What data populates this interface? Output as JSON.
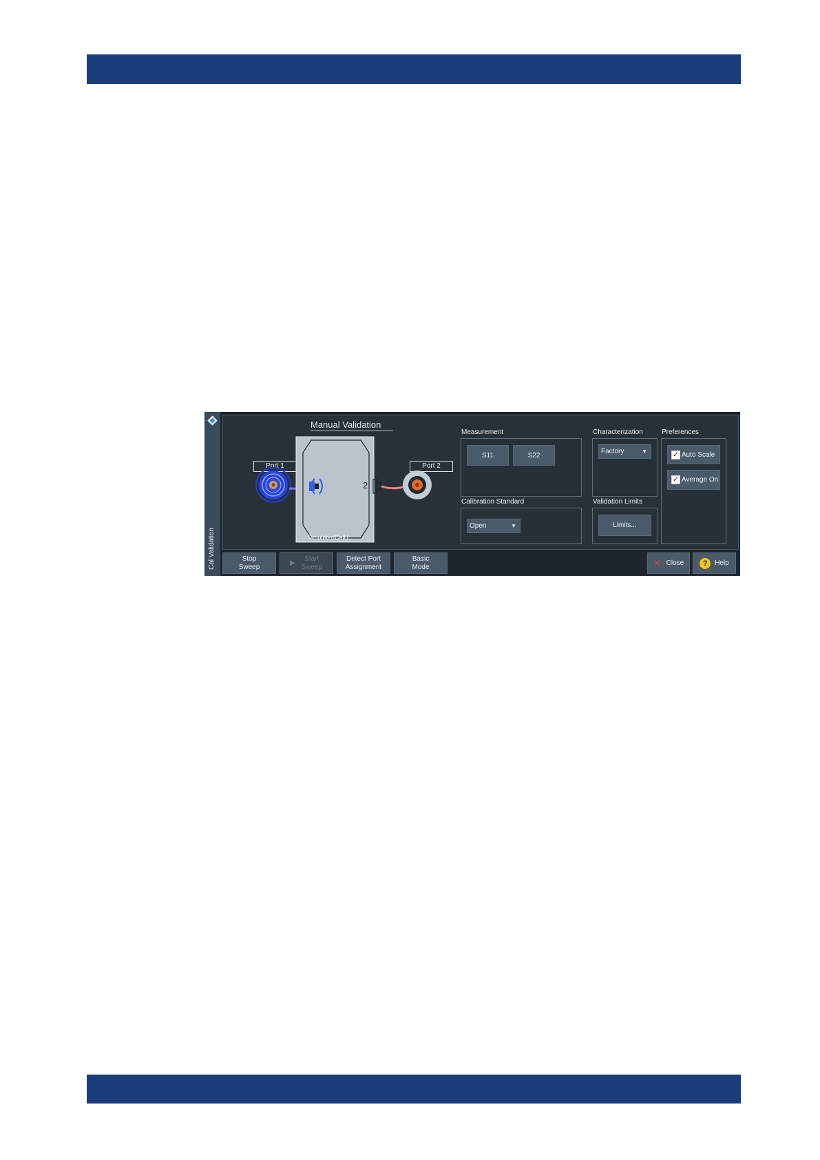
{
  "dialog": {
    "side_title": "Cal Validation",
    "title": "Manual Validation",
    "port1_label": "Port 1",
    "port2_label": "Port 2",
    "port_number": "2",
    "calkit_name": "SimulatedCalU",
    "measurement": {
      "label": "Measurement",
      "buttons": [
        "S11",
        "S22"
      ]
    },
    "characterization": {
      "label": "Characterization",
      "selected": "Factory"
    },
    "preferences": {
      "label": "Preferences",
      "auto_scale": {
        "label": "Auto Scale",
        "checked": true
      },
      "average_on": {
        "label": "Average On",
        "checked": true
      }
    },
    "calibration_standard": {
      "label": "Calibration Standard",
      "selected": "Open"
    },
    "validation_limits": {
      "label": "Validation Limits",
      "button": "Limits..."
    },
    "toolbar": {
      "stop_sweep": "Stop Sweep",
      "start_sweep": "Start Sweep",
      "detect_port": "Detect Port Assignment",
      "basic_mode": "Basic Mode",
      "close": "Close",
      "help": "Help"
    }
  },
  "colors": {
    "doc_bar": "#1a3c7a",
    "dialog_bg": "#1d262e",
    "panel_bg": "#283138",
    "button": "#4a5a68",
    "port1_cable": "#8b6cf0",
    "port2_cable": "#f08080",
    "close_x": "#e53935",
    "help_icon": "#f5c518"
  }
}
